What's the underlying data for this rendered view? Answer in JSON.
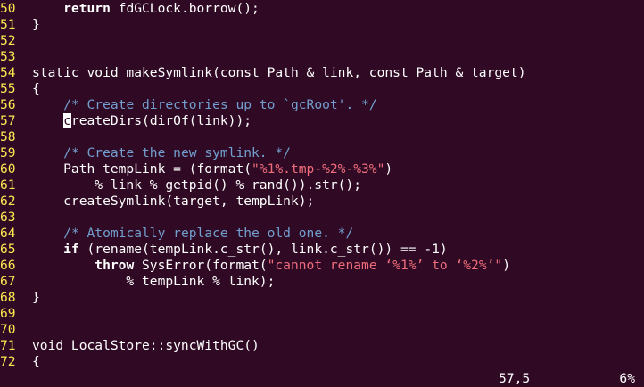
{
  "editor": {
    "lines": [
      {
        "n": "50",
        "t": [
          {
            "k": "p",
            "s": "    "
          },
          {
            "k": "kw",
            "s": "return"
          },
          {
            "k": "p",
            "s": " fdGCLock.borrow();"
          }
        ]
      },
      {
        "n": "51",
        "t": [
          {
            "k": "p",
            "s": "}"
          }
        ]
      },
      {
        "n": "52",
        "t": []
      },
      {
        "n": "53",
        "t": []
      },
      {
        "n": "54",
        "t": [
          {
            "k": "p",
            "s": "static void makeSymlink(const Path & link, const Path & target)"
          }
        ]
      },
      {
        "n": "55",
        "t": [
          {
            "k": "p",
            "s": "{"
          }
        ]
      },
      {
        "n": "56",
        "t": [
          {
            "k": "p",
            "s": "    "
          },
          {
            "k": "cm",
            "s": "/* Create directories up to `gcRoot'. */"
          }
        ]
      },
      {
        "n": "57",
        "t": [
          {
            "k": "p",
            "s": "    "
          },
          {
            "k": "cur",
            "s": "c"
          },
          {
            "k": "p",
            "s": "reateDirs(dirOf(link));"
          }
        ]
      },
      {
        "n": "58",
        "t": []
      },
      {
        "n": "59",
        "t": [
          {
            "k": "p",
            "s": "    "
          },
          {
            "k": "cm",
            "s": "/* Create the new symlink. */"
          }
        ]
      },
      {
        "n": "60",
        "t": [
          {
            "k": "p",
            "s": "    Path tempLink = (format("
          },
          {
            "k": "str",
            "s": "\"%1%.tmp-%2%-%3%\""
          },
          {
            "k": "p",
            "s": ")"
          }
        ]
      },
      {
        "n": "61",
        "t": [
          {
            "k": "p",
            "s": "        % link % getpid() % rand()).str();"
          }
        ]
      },
      {
        "n": "62",
        "t": [
          {
            "k": "p",
            "s": "    createSymlink(target, tempLink);"
          }
        ]
      },
      {
        "n": "63",
        "t": []
      },
      {
        "n": "64",
        "t": [
          {
            "k": "p",
            "s": "    "
          },
          {
            "k": "cm",
            "s": "/* Atomically replace the old one. */"
          }
        ]
      },
      {
        "n": "65",
        "t": [
          {
            "k": "p",
            "s": "    "
          },
          {
            "k": "kw",
            "s": "if"
          },
          {
            "k": "p",
            "s": " (rename(tempLink.c_str(), link.c_str()) == -1)"
          }
        ]
      },
      {
        "n": "66",
        "t": [
          {
            "k": "p",
            "s": "        "
          },
          {
            "k": "kw",
            "s": "throw"
          },
          {
            "k": "p",
            "s": " SysError(format("
          },
          {
            "k": "str",
            "s": "\"cannot rename ‘%1%’ to ‘%2%’\""
          },
          {
            "k": "p",
            "s": ")"
          }
        ]
      },
      {
        "n": "67",
        "t": [
          {
            "k": "p",
            "s": "            % tempLink % link);"
          }
        ]
      },
      {
        "n": "68",
        "t": [
          {
            "k": "p",
            "s": "}"
          }
        ]
      },
      {
        "n": "69",
        "t": []
      },
      {
        "n": "70",
        "t": []
      },
      {
        "n": "71",
        "t": [
          {
            "k": "p",
            "s": "void LocalStore::syncWithGC()"
          }
        ]
      },
      {
        "n": "72",
        "t": [
          {
            "k": "p",
            "s": "{"
          }
        ]
      }
    ]
  },
  "status": {
    "cursor_position": "57,5",
    "scroll_percent": "6%"
  },
  "colors": {
    "background": "#300a24",
    "line_numbers": "#fce94f",
    "comments": "#729fcf",
    "strings": "#ef6c7a",
    "text": "#ffffff"
  }
}
